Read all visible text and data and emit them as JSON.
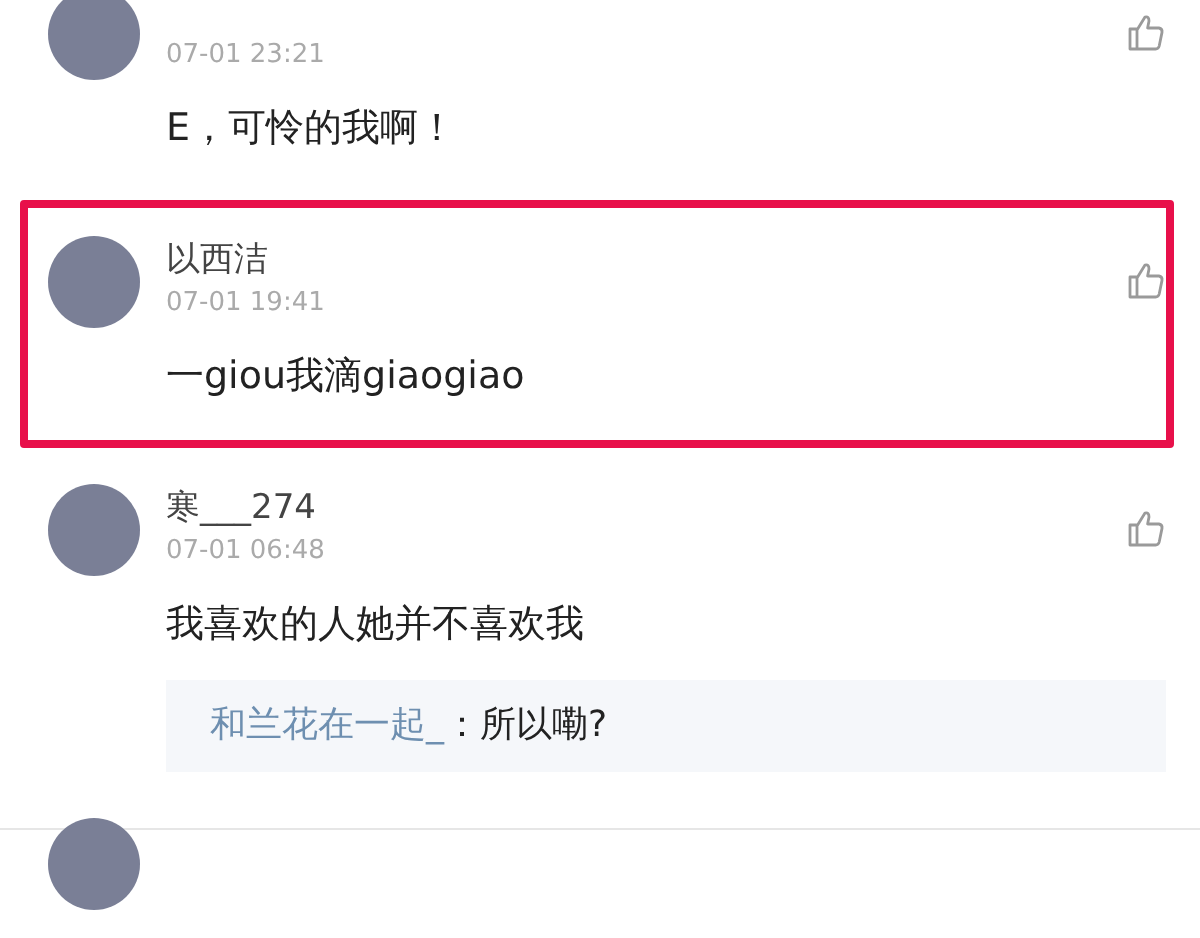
{
  "comments": [
    {
      "time": "07-01 23:21",
      "text": "E，可怜的我啊！",
      "highlighted": false
    },
    {
      "name": "以西洁",
      "time": "07-01 19:41",
      "text": "一giou我滴giaogiao",
      "highlighted": true
    },
    {
      "name": "寒___274",
      "time": "07-01 06:48",
      "text": "我喜欢的人她并不喜欢我",
      "highlighted": false,
      "replies": [
        {
          "author": "和兰花在一起_",
          "text": "：所以嘞?"
        }
      ]
    },
    {
      "highlighted": false
    }
  ]
}
